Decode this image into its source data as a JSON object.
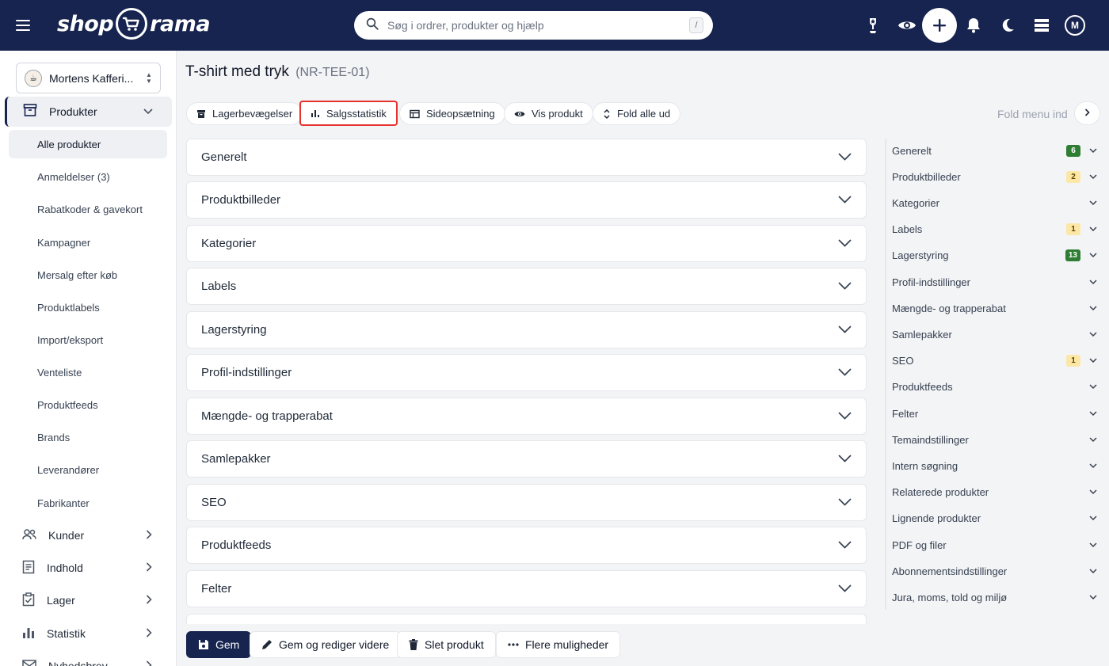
{
  "brand": {
    "logo_left": "shop",
    "logo_right": "rama"
  },
  "search": {
    "placeholder": "Søg i ordrer, produkter og hjælp",
    "shortcut": "/"
  },
  "user": {
    "avatar_initial": "M"
  },
  "sidebar": {
    "shop_name": "Mortens Kafferi...",
    "produkter_label": "Produkter",
    "sub_items": [
      "Alle produkter",
      "Anmeldelser (3)",
      "Rabatkoder & gavekort",
      "Kampagner",
      "Mersalg efter køb",
      "Produktlabels",
      "Import/eksport",
      "Venteliste",
      "Produktfeeds",
      "Brands",
      "Leverandører",
      "Fabrikanter"
    ],
    "main_items": [
      "Kunder",
      "Indhold",
      "Lager",
      "Statistik",
      "Nyhedsbrev"
    ]
  },
  "page": {
    "title": "T-shirt med tryk",
    "sku": "(NR-TEE-01)"
  },
  "toolbar": {
    "lager": "Lagerbevægelser",
    "salgsstatistik": "Salgsstatistik",
    "sideopsaetning": "Sideopsætning",
    "vis_produkt": "Vis produkt",
    "fold_alle_ud": "Fold alle ud",
    "fold_menu_ind": "Fold menu ind"
  },
  "sections": [
    "Generelt",
    "Produktbilleder",
    "Kategorier",
    "Labels",
    "Lagerstyring",
    "Profil-indstillinger",
    "Mængde- og trapperabat",
    "Samlepakker",
    "SEO",
    "Produktfeeds",
    "Felter"
  ],
  "right_menu": [
    {
      "label": "Generelt",
      "badge": "6",
      "badge_color": "green"
    },
    {
      "label": "Produktbilleder",
      "badge": "2",
      "badge_color": "yellow"
    },
    {
      "label": "Kategorier",
      "badge": "",
      "badge_color": ""
    },
    {
      "label": "Labels",
      "badge": "1",
      "badge_color": "yellow"
    },
    {
      "label": "Lagerstyring",
      "badge": "13",
      "badge_color": "green"
    },
    {
      "label": "Profil-indstillinger",
      "badge": "",
      "badge_color": ""
    },
    {
      "label": "Mængde- og trapperabat",
      "badge": "",
      "badge_color": ""
    },
    {
      "label": "Samlepakker",
      "badge": "",
      "badge_color": ""
    },
    {
      "label": "SEO",
      "badge": "1",
      "badge_color": "yellow"
    },
    {
      "label": "Produktfeeds",
      "badge": "",
      "badge_color": ""
    },
    {
      "label": "Felter",
      "badge": "",
      "badge_color": ""
    },
    {
      "label": "Temaindstillinger",
      "badge": "",
      "badge_color": ""
    },
    {
      "label": "Intern søgning",
      "badge": "",
      "badge_color": ""
    },
    {
      "label": "Relaterede produkter",
      "badge": "",
      "badge_color": ""
    },
    {
      "label": "Lignende produkter",
      "badge": "",
      "badge_color": ""
    },
    {
      "label": "PDF og filer",
      "badge": "",
      "badge_color": ""
    },
    {
      "label": "Abonnementsindstillinger",
      "badge": "",
      "badge_color": ""
    },
    {
      "label": "Jura, moms, told og miljø",
      "badge": "",
      "badge_color": ""
    }
  ],
  "bottom": {
    "save": "Gem",
    "save_continue": "Gem og rediger videre",
    "delete": "Slet produkt",
    "more": "Flere muligheder"
  },
  "colors": {
    "navy": "#17244f",
    "highlight_red": "#e5322d",
    "badge_green": "#2e7d32",
    "badge_yellow": "#fde7a7"
  }
}
